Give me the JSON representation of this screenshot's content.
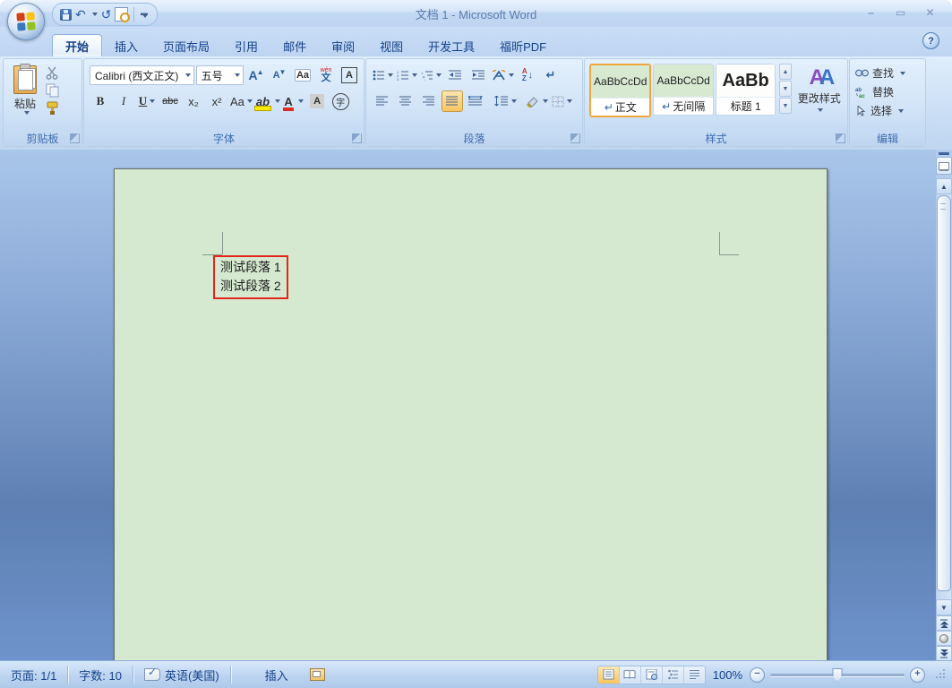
{
  "window": {
    "title": "文档 1 - Microsoft Word",
    "controls": {
      "minimize": "–",
      "maximize": "▭",
      "close": "✕"
    },
    "help": "?"
  },
  "tabs": [
    {
      "label": "开始",
      "active": true
    },
    {
      "label": "插入"
    },
    {
      "label": "页面布局"
    },
    {
      "label": "引用"
    },
    {
      "label": "邮件"
    },
    {
      "label": "审阅"
    },
    {
      "label": "视图"
    },
    {
      "label": "开发工具"
    },
    {
      "label": "福昕PDF"
    }
  ],
  "ribbon": {
    "clipboard": {
      "label": "剪贴板",
      "paste": "粘贴"
    },
    "font": {
      "label": "字体",
      "name": "Calibri (西文正文)",
      "size": "五号",
      "grow": "A",
      "shrink": "A",
      "clear": "Aa",
      "pinyin_top": "wén",
      "pinyin_bottom": "文",
      "char_border": "A",
      "bold": "B",
      "italic": "I",
      "underline": "U",
      "strike": "abc",
      "subscript": "x₂",
      "superscript": "x²",
      "case": "Aa",
      "highlight": "ab",
      "font_color": "A",
      "char_shade": "A",
      "enclose": "字"
    },
    "paragraph": {
      "label": "段落",
      "sort_a": "A",
      "sort_z": "Z",
      "sort_arrow": "↓",
      "mark": "↵"
    },
    "styles": {
      "label": "样式",
      "items": [
        {
          "preview": "AaBbCcDd",
          "prefix": "↵",
          "name": "正文",
          "selected": true
        },
        {
          "preview": "AaBbCcDd",
          "prefix": "↵",
          "name": "无间隔",
          "selected": false
        },
        {
          "preview": "AaBb",
          "prefix": "",
          "name": "标题 1",
          "selected": false
        }
      ],
      "change_styles": "更改样式",
      "aa1": "A",
      "aa2": "A"
    },
    "editing": {
      "label": "编辑",
      "find": "查找",
      "replace": "替换",
      "select": "选择"
    }
  },
  "document": {
    "paragraphs": [
      "测试段落 1",
      "测试段落 2"
    ]
  },
  "scrollbar": {
    "up": "▲",
    "down": "▼"
  },
  "status_bar": {
    "page": "页面: 1/1",
    "words": "字数: 10",
    "language": "英语(美国)",
    "insert_mode": "插入",
    "zoom": "100%",
    "zoom_out": "−",
    "zoom_in": "+"
  },
  "colors": {
    "page_bg": "#d5e9d0",
    "redbox_border": "#e3251b",
    "selection_orange": "#f0a73c",
    "titlebar_text": "#5a7dad",
    "accent_blue": "#15428b"
  }
}
